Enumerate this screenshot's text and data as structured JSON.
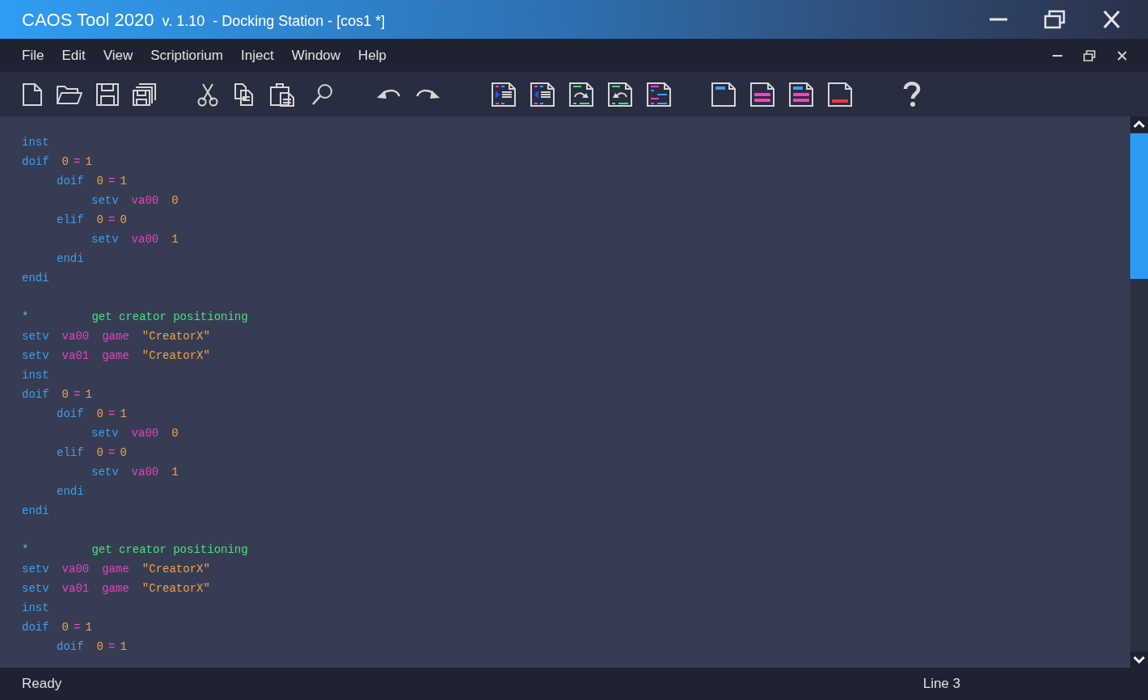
{
  "window": {
    "title": "CAOS Tool 2020",
    "version": "v. 1.10",
    "document": "- Docking Station - [cos1 *]"
  },
  "menu": [
    "File",
    "Edit",
    "View",
    "Scriptiorium",
    "Inject",
    "Window",
    "Help"
  ],
  "editor": {
    "lines": [
      {
        "kind": "code",
        "tokens": [
          {
            "kind": "keyword",
            "text": "inst"
          }
        ]
      },
      {
        "kind": "code",
        "tokens": [
          {
            "kind": "keyword",
            "text": "doif"
          },
          {
            "kind": "number",
            "text": "0"
          },
          {
            "kind": "operator",
            "text": "="
          },
          {
            "kind": "number",
            "text": "1"
          }
        ],
        "children": [
          {
            "kind": "code",
            "tokens": [
              {
                "kind": "keyword",
                "text": "doif"
              },
              {
                "kind": "number",
                "text": "0"
              },
              {
                "kind": "operator",
                "text": "="
              },
              {
                "kind": "number",
                "text": "1"
              }
            ],
            "children": [
              {
                "kind": "code",
                "tokens": [
                  {
                    "kind": "keyword",
                    "text": "setv"
                  },
                  {
                    "kind": "variable",
                    "text": "va00"
                  },
                  {
                    "kind": "number",
                    "text": "0"
                  }
                ]
              }
            ]
          },
          {
            "kind": "code",
            "tokens": [
              {
                "kind": "keyword",
                "text": "elif"
              },
              {
                "kind": "number",
                "text": "0"
              },
              {
                "kind": "operator",
                "text": "="
              },
              {
                "kind": "number",
                "text": "0"
              }
            ],
            "children": [
              {
                "kind": "code",
                "tokens": [
                  {
                    "kind": "keyword",
                    "text": "setv"
                  },
                  {
                    "kind": "variable",
                    "text": "va00"
                  },
                  {
                    "kind": "number",
                    "text": "1"
                  }
                ]
              }
            ]
          },
          {
            "kind": "code",
            "tokens": [
              {
                "kind": "keyword",
                "text": "endi"
              }
            ]
          }
        ]
      },
      {
        "kind": "code",
        "tokens": [
          {
            "kind": "keyword",
            "text": "endi"
          }
        ]
      },
      {
        "kind": "blank"
      },
      {
        "kind": "code",
        "tokens": [
          {
            "kind": "comment-marker",
            "text": "*"
          },
          {
            "kind": "comment",
            "text": "get creator positioning"
          }
        ]
      },
      {
        "kind": "code",
        "tokens": [
          {
            "kind": "keyword",
            "text": "setv"
          },
          {
            "kind": "variable",
            "text": "va00"
          },
          {
            "kind": "variable",
            "text": "game"
          },
          {
            "kind": "string",
            "text": "\"CreatorX\""
          }
        ]
      },
      {
        "kind": "code",
        "tokens": [
          {
            "kind": "keyword",
            "text": "setv"
          },
          {
            "kind": "variable",
            "text": "va01"
          },
          {
            "kind": "variable",
            "text": "game"
          },
          {
            "kind": "string",
            "text": "\"CreatorX\""
          }
        ]
      },
      {
        "kind": "code",
        "tokens": [
          {
            "kind": "keyword",
            "text": "inst"
          }
        ]
      },
      {
        "kind": "code",
        "tokens": [
          {
            "kind": "keyword",
            "text": "doif"
          },
          {
            "kind": "number",
            "text": "0"
          },
          {
            "kind": "operator",
            "text": "="
          },
          {
            "kind": "number",
            "text": "1"
          }
        ],
        "children": [
          {
            "kind": "code",
            "tokens": [
              {
                "kind": "keyword",
                "text": "doif"
              },
              {
                "kind": "number",
                "text": "0"
              },
              {
                "kind": "operator",
                "text": "="
              },
              {
                "kind": "number",
                "text": "1"
              }
            ],
            "children": [
              {
                "kind": "code",
                "tokens": [
                  {
                    "kind": "keyword",
                    "text": "setv"
                  },
                  {
                    "kind": "variable",
                    "text": "va00"
                  },
                  {
                    "kind": "number",
                    "text": "0"
                  }
                ]
              }
            ]
          },
          {
            "kind": "code",
            "tokens": [
              {
                "kind": "keyword",
                "text": "elif"
              },
              {
                "kind": "number",
                "text": "0"
              },
              {
                "kind": "operator",
                "text": "="
              },
              {
                "kind": "number",
                "text": "0"
              }
            ],
            "children": [
              {
                "kind": "code",
                "tokens": [
                  {
                    "kind": "keyword",
                    "text": "setv"
                  },
                  {
                    "kind": "variable",
                    "text": "va00"
                  },
                  {
                    "kind": "number",
                    "text": "1"
                  }
                ]
              }
            ]
          },
          {
            "kind": "code",
            "tokens": [
              {
                "kind": "keyword",
                "text": "endi"
              }
            ]
          }
        ]
      },
      {
        "kind": "code",
        "tokens": [
          {
            "kind": "keyword",
            "text": "endi"
          }
        ]
      },
      {
        "kind": "blank"
      },
      {
        "kind": "code",
        "tokens": [
          {
            "kind": "comment-marker",
            "text": "*"
          },
          {
            "kind": "comment",
            "text": "get creator positioning"
          }
        ]
      },
      {
        "kind": "code",
        "tokens": [
          {
            "kind": "keyword",
            "text": "setv"
          },
          {
            "kind": "variable",
            "text": "va00"
          },
          {
            "kind": "variable",
            "text": "game"
          },
          {
            "kind": "string",
            "text": "\"CreatorX\""
          }
        ]
      },
      {
        "kind": "code",
        "tokens": [
          {
            "kind": "keyword",
            "text": "setv"
          },
          {
            "kind": "variable",
            "text": "va01"
          },
          {
            "kind": "variable",
            "text": "game"
          },
          {
            "kind": "string",
            "text": "\"CreatorX\""
          }
        ]
      },
      {
        "kind": "code",
        "tokens": [
          {
            "kind": "keyword",
            "text": "inst"
          }
        ]
      },
      {
        "kind": "code",
        "tokens": [
          {
            "kind": "keyword",
            "text": "doif"
          },
          {
            "kind": "number",
            "text": "0"
          },
          {
            "kind": "operator",
            "text": "="
          },
          {
            "kind": "number",
            "text": "1"
          }
        ],
        "children": [
          {
            "kind": "code",
            "tokens": [
              {
                "kind": "keyword",
                "text": "doif"
              },
              {
                "kind": "number",
                "text": "0"
              },
              {
                "kind": "operator",
                "text": "="
              },
              {
                "kind": "number",
                "text": "1"
              }
            ]
          }
        ]
      }
    ]
  },
  "status_bar": {
    "message": "Ready",
    "position": "Line 3"
  }
}
